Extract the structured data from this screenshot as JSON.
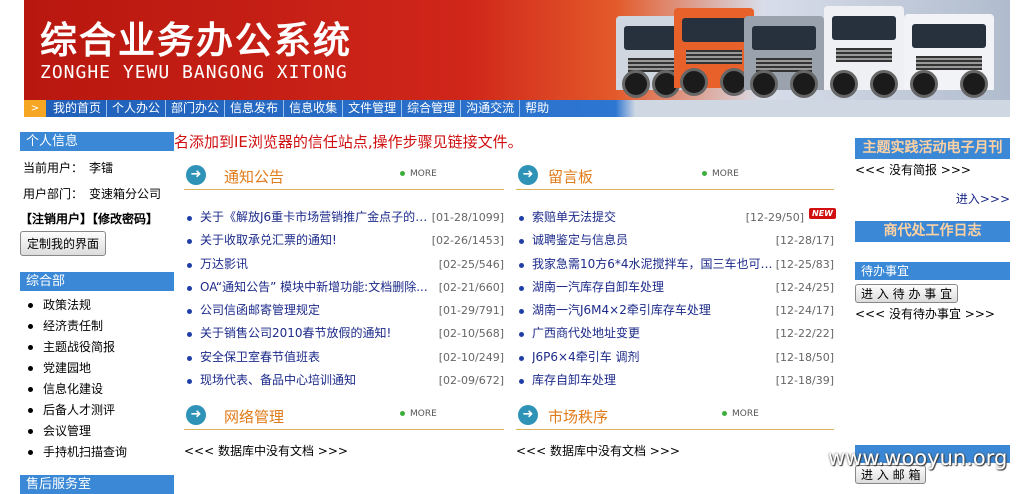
{
  "banner": {
    "title": "综合业务办公系统",
    "subtitle": "ZONGHE YEWU BANGONG XITONG"
  },
  "nav": {
    "items": [
      "我的首页",
      "个人办公",
      "部门办公",
      "信息发布",
      "信息收集",
      "文件管理",
      "综合管理",
      "沟通交流",
      "帮助"
    ]
  },
  "marquee": "名添加到IE浏览器的信任站点,操作步骤见链接文件。",
  "left": {
    "personal_header": "个人信息",
    "current_user_label": "当前用户：",
    "current_user": "李镭",
    "dept_label": "用户部门：",
    "dept": "变速箱分公司",
    "logout": "【注销用户】",
    "change_password": "【修改密码】",
    "customize_button": "定制我的界面",
    "dept_section_header": "综合部",
    "menu": [
      "政策法规",
      "经济责任制",
      "主题战役简报",
      "党建园地",
      "信息化建设",
      "后备人才测评",
      "会议管理",
      "手持机扫描查询"
    ],
    "service_header": "售后服务室"
  },
  "notice": {
    "title": "通知公告",
    "more": "MORE",
    "items": [
      {
        "text": "关于《解放J6重卡市场营销推广金点子的征...",
        "date": "[01-28/1099]"
      },
      {
        "text": "关于收取承兑汇票的通知!",
        "date": "[02-26/1453]"
      },
      {
        "text": "万达影讯",
        "date": "[02-25/546]"
      },
      {
        "text": "OA“通知公告” 模块中新增功能:文档删除...",
        "date": "[02-21/660]"
      },
      {
        "text": "公司信函邮寄管理规定",
        "date": "[01-29/791]"
      },
      {
        "text": "关于销售公司2010春节放假的通知!",
        "date": "[02-10/568]"
      },
      {
        "text": "安全保卫室春节值班表",
        "date": "[02-10/249]"
      },
      {
        "text": "现场代表、备品中心培训通知",
        "date": "[02-09/672]"
      }
    ]
  },
  "message": {
    "title": "留言板",
    "more": "MORE",
    "new_badge": "NEW",
    "items": [
      {
        "text": "索赔单无法提交",
        "date": "[12-29/50]"
      },
      {
        "text": "诚聘鉴定与信息员",
        "date": "[12-28/17]"
      },
      {
        "text": "我家急需10方6*4水泥搅拌车，国三车也可。...",
        "date": "[12-25/83]"
      },
      {
        "text": "湖南一汽库存自卸车处理",
        "date": "[12-24/25]"
      },
      {
        "text": "湖南一汽J6M4×2牵引库存车处理",
        "date": "[12-24/17]"
      },
      {
        "text": "广西商代处地址变更",
        "date": "[12-22/22]"
      },
      {
        "text": "J6P6×4牵引车  调剂",
        "date": "[12-18/50]"
      },
      {
        "text": "库存自卸车处理",
        "date": "[12-18/39]"
      }
    ]
  },
  "network": {
    "title": "网络管理",
    "more": "MORE",
    "empty": "<<< 数据库中没有文档  >>>"
  },
  "market": {
    "title": "市场秩序",
    "more": "MORE",
    "empty": "<<< 数据库中没有文档  >>>"
  },
  "right": {
    "journal_header": "主题实践活动电子月刊",
    "no_brief": "<<< 没有简报  >>>",
    "enter": "进入>>>",
    "work_log_header": "商代处工作日志",
    "todo_header": "待办事宜",
    "todo_button": "进 入 待 办 事 宜",
    "no_todo": "<<< 没有待办事宜  >>>",
    "mail_button": "进 入 邮 箱"
  },
  "watermark": "www.wooyun.org",
  "colors": {
    "accent_blue": "#3a88d6",
    "title_orange": "#e07b1a",
    "marquee_red": "#d01010"
  }
}
